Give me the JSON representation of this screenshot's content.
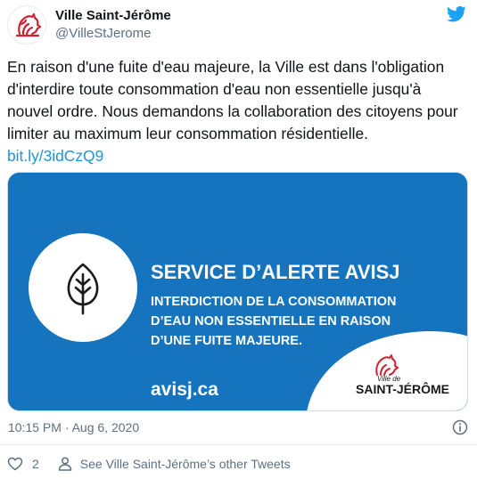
{
  "author": {
    "name": "Ville Saint-Jérôme",
    "handle": "@VilleStJerome"
  },
  "tweet": {
    "text": "En raison d'une fuite d'eau majeure, la Ville est dans l'obligation d'interdire toute consommation d'eau non essentielle jusqu'à nouvel ordre. Nous demandons la collaboration des citoyens pour limiter au maximum leur consommation résidentielle. ",
    "link": "bit.ly/3idCzQ9"
  },
  "card": {
    "title": "SERVICE D’ALERTE AVISJ",
    "subtitle_lines": [
      "INTERDICTION DE LA CONSOMMATION",
      "D’EAU NON ESSENTIELLE EN RAISON",
      "D’UNE FUITE MAJEURE."
    ],
    "url": "avisj.ca",
    "logo_small": "Ville de",
    "logo_big": "SAINT-JÉRÔME",
    "icon": "leaf-icon"
  },
  "meta": {
    "timestamp": "10:15 PM · Aug 6, 2020"
  },
  "actions": {
    "like_count": "2",
    "other_tweets": "See Ville Saint-Jérôme’s other Tweets"
  },
  "colors": {
    "card_blue": "#1673bd",
    "brand_red": "#d1202f",
    "link": "#1b95e0",
    "twitter": "#1da1f2"
  }
}
